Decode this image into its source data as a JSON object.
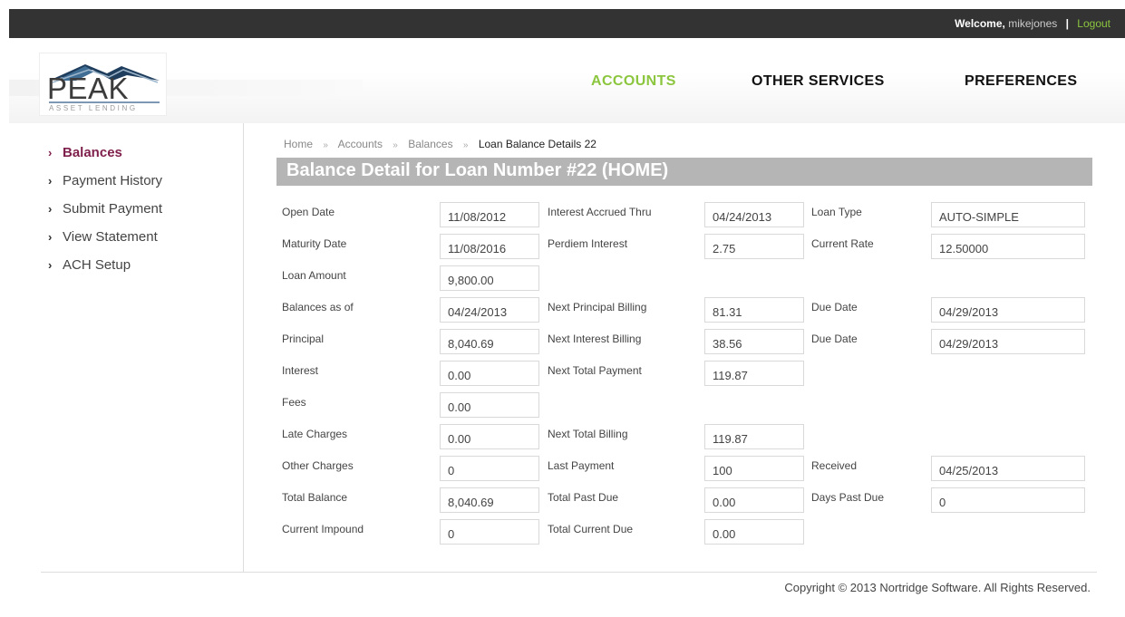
{
  "topbar": {
    "welcome_label": "Welcome,",
    "username": "mikejones",
    "separator": "|",
    "logout_label": "Logout"
  },
  "logo": {
    "brand": "PEAK",
    "tagline": "ASSET LENDING"
  },
  "nav": {
    "accounts": "ACCOUNTS",
    "other_services": "OTHER SERVICES",
    "preferences": "PREFERENCES"
  },
  "sidebar": {
    "items": [
      {
        "label": "Balances",
        "active": true
      },
      {
        "label": "Payment History",
        "active": false
      },
      {
        "label": "Submit Payment",
        "active": false
      },
      {
        "label": "View Statement",
        "active": false
      },
      {
        "label": "ACH Setup",
        "active": false
      }
    ]
  },
  "breadcrumb": {
    "home": "Home",
    "accounts": "Accounts",
    "balances": "Balances",
    "current": "Loan Balance Details 22",
    "separator": "»"
  },
  "page_title": "Balance Detail for Loan Number #22 (HOME)",
  "fields": {
    "open_date": {
      "label": "Open Date",
      "value": "11/08/2012"
    },
    "interest_accrued_thru": {
      "label": "Interest Accrued Thru",
      "value": "04/24/2013"
    },
    "loan_type": {
      "label": "Loan Type",
      "value": "AUTO-SIMPLE"
    },
    "maturity_date": {
      "label": "Maturity Date",
      "value": "11/08/2016"
    },
    "perdiem_interest": {
      "label": "Perdiem Interest",
      "value": "2.75"
    },
    "current_rate": {
      "label": "Current Rate",
      "value": "12.50000"
    },
    "loan_amount": {
      "label": "Loan Amount",
      "value": "9,800.00"
    },
    "balances_as_of": {
      "label": "Balances as of",
      "value": "04/24/2013"
    },
    "next_principal_billing": {
      "label": "Next Principal Billing",
      "value": "81.31"
    },
    "due_date_1": {
      "label": "Due Date",
      "value": "04/29/2013"
    },
    "principal": {
      "label": "Principal",
      "value": "8,040.69"
    },
    "next_interest_billing": {
      "label": "Next Interest Billing",
      "value": "38.56"
    },
    "due_date_2": {
      "label": "Due Date",
      "value": "04/29/2013"
    },
    "interest": {
      "label": "Interest",
      "value": "0.00"
    },
    "next_total_payment": {
      "label": "Next Total Payment",
      "value": "119.87"
    },
    "fees": {
      "label": "Fees",
      "value": "0.00"
    },
    "late_charges": {
      "label": "Late Charges",
      "value": "0.00"
    },
    "next_total_billing": {
      "label": "Next Total Billing",
      "value": "119.87"
    },
    "other_charges": {
      "label": "Other Charges",
      "value": "0"
    },
    "last_payment": {
      "label": "Last Payment",
      "value": "100"
    },
    "received": {
      "label": "Received",
      "value": "04/25/2013"
    },
    "total_balance": {
      "label": "Total Balance",
      "value": "8,040.69"
    },
    "total_past_due": {
      "label": "Total Past Due",
      "value": "0.00"
    },
    "days_past_due": {
      "label": "Days Past Due",
      "value": "0"
    },
    "current_impound": {
      "label": "Current Impound",
      "value": "0"
    },
    "total_current_due": {
      "label": "Total Current Due",
      "value": "0.00"
    }
  },
  "footer": {
    "copyright": "Copyright © 2013 Nortridge Software. All Rights Reserved."
  },
  "colors": {
    "accent_green": "#8cc63f",
    "active_purple": "#7f1f4b",
    "title_bar_gray": "#b5b5b5",
    "topbar_dark": "#333333"
  }
}
